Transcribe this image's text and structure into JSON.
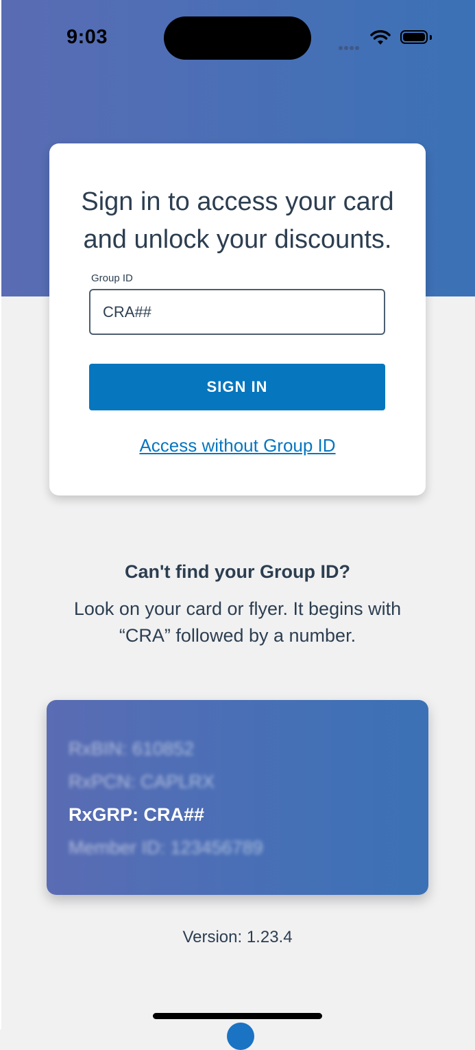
{
  "status_bar": {
    "time": "9:03",
    "icons": [
      "signal-icon",
      "wifi-icon",
      "battery-icon"
    ]
  },
  "colors": {
    "hero_start": "#5a6cb3",
    "hero_end": "#3b71b6",
    "primary": "#0676bf",
    "text": "#2c3e50",
    "background": "#f1f1f2"
  },
  "signin_card": {
    "heading_line1": "Sign in to access your card",
    "heading_line2": "and unlock your discounts.",
    "group_id_label": "Group ID",
    "group_id_value": "CRA##",
    "signin_label": "SIGN IN",
    "access_link": "Access without Group ID"
  },
  "help": {
    "title": "Can't find your Group ID?",
    "line1": "Look on your card or flyer. It begins with",
    "line2": "“CRA” followed by a number."
  },
  "sample_card": {
    "rxbin": "RxBIN: 610852",
    "rxpcn": "RxPCN: CAPLRX",
    "rxgrp": "RxGRP: CRA##",
    "member_id": "Member ID: 123456789"
  },
  "footer": {
    "version": "Version: 1.23.4"
  }
}
